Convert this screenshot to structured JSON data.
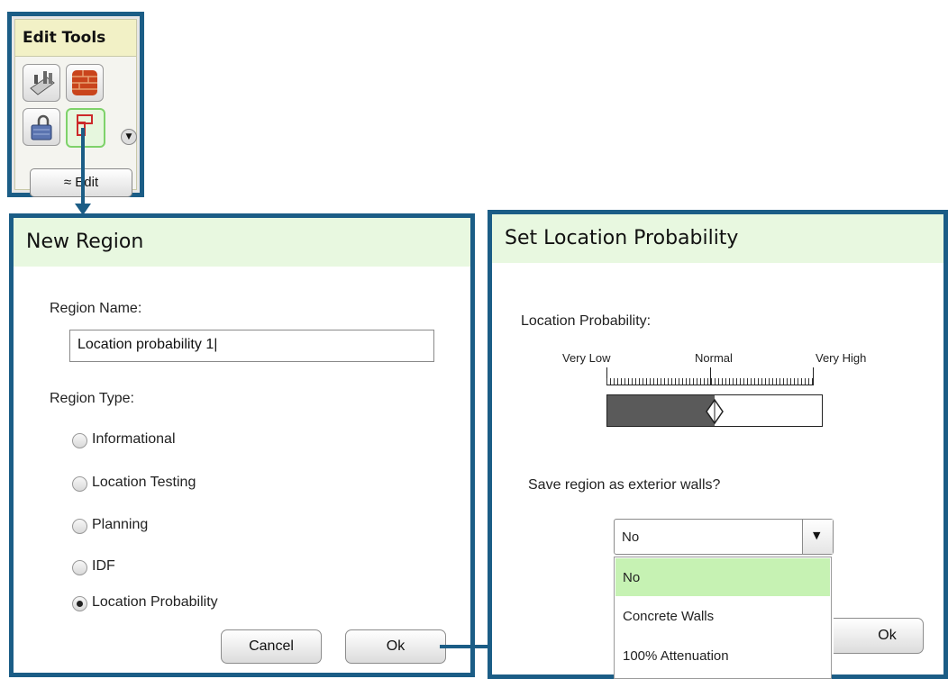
{
  "edit_tools": {
    "title": "Edit Tools",
    "edit_button": "Edit",
    "edit_button_icon": "double-chevron-up-icon",
    "tools": [
      "wall-tool-icon",
      "brick-wall-icon",
      "lock-icon",
      "region-tool-icon"
    ]
  },
  "new_region": {
    "title": "New Region",
    "name_label": "Region Name:",
    "name_value": "Location probability 1",
    "type_label": "Region Type:",
    "types": [
      {
        "label": "Informational",
        "selected": false
      },
      {
        "label": "Location Testing",
        "selected": false
      },
      {
        "label": "Planning",
        "selected": false
      },
      {
        "label": "IDF",
        "selected": false
      },
      {
        "label": "Location Probability",
        "selected": true
      }
    ],
    "cancel": "Cancel",
    "ok": "Ok"
  },
  "set_probability": {
    "title": "Set Location Probability",
    "prob_label": "Location Probability:",
    "scale_low": "Very Low",
    "scale_mid": "Normal",
    "scale_high": "Very High",
    "slider_level": 0.5,
    "walls_question": "Save region as exterior walls?",
    "select_value": "No",
    "options": [
      "No",
      "Concrete Walls",
      "100% Attenuation"
    ],
    "highlighted_option": 0,
    "ok": "Ok"
  },
  "colors": {
    "frame": "#1b5d86",
    "title_bg": "#e8f8e0",
    "highlight": "#c6f2b3",
    "slider_fill": "#5a5a5a"
  }
}
